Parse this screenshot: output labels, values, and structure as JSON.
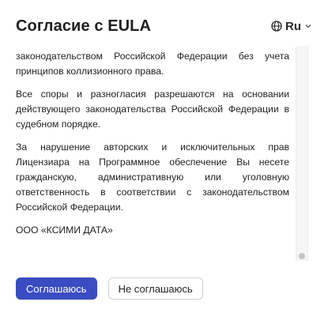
{
  "dialog": {
    "title": "Согласие с EULA",
    "language": {
      "label": "Ru",
      "icon": "globe-icon",
      "chevron": "chevron-down-icon"
    }
  },
  "content": {
    "paragraphs": [
      "законодательством Российской Федерации без учета принципов коллизионного права.",
      "Все споры и разногласия разрешаются на основании действующего законодательства Российской Федерации в судебном порядке.",
      "За нарушение авторских и исключительных прав Лицензиара на Программное обеспечение Вы несете гражданскую, административную или уголовную ответственность в соответствии с законодательством Российской Федерации.",
      "ООО «КСИМИ ДАТА»"
    ]
  },
  "actions": {
    "agree_label": "Соглашаюсь",
    "disagree_label": "Не соглашаюсь"
  },
  "colors": {
    "primary": "#3a4cc1",
    "text": "#1f1f1f",
    "border": "#cfcfcf"
  }
}
